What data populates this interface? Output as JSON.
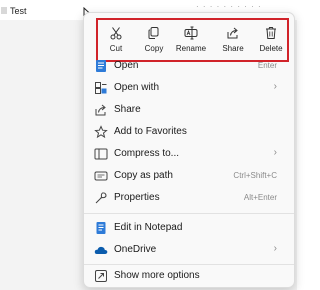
{
  "file": {
    "name": "Test"
  },
  "quick_actions": [
    {
      "label": "Cut",
      "icon": "scissors-icon"
    },
    {
      "label": "Copy",
      "icon": "copy-icon"
    },
    {
      "label": "Rename",
      "icon": "rename-icon"
    },
    {
      "label": "Share",
      "icon": "share-icon"
    },
    {
      "label": "Delete",
      "icon": "trash-icon"
    }
  ],
  "menu": {
    "open": {
      "label": "Open",
      "shortcut": "Enter"
    },
    "open_with": {
      "label": "Open with"
    },
    "share": {
      "label": "Share"
    },
    "favorites": {
      "label": "Add to Favorites"
    },
    "compress": {
      "label": "Compress to..."
    },
    "copy_path": {
      "label": "Copy as path",
      "shortcut": "Ctrl+Shift+C"
    },
    "properties": {
      "label": "Properties",
      "shortcut": "Alt+Enter"
    },
    "notepad": {
      "label": "Edit in Notepad"
    },
    "onedrive": {
      "label": "OneDrive"
    },
    "more": {
      "label": "Show more options"
    }
  },
  "colors": {
    "highlight_border": "#d1232a",
    "accent": "#0b5cad"
  }
}
